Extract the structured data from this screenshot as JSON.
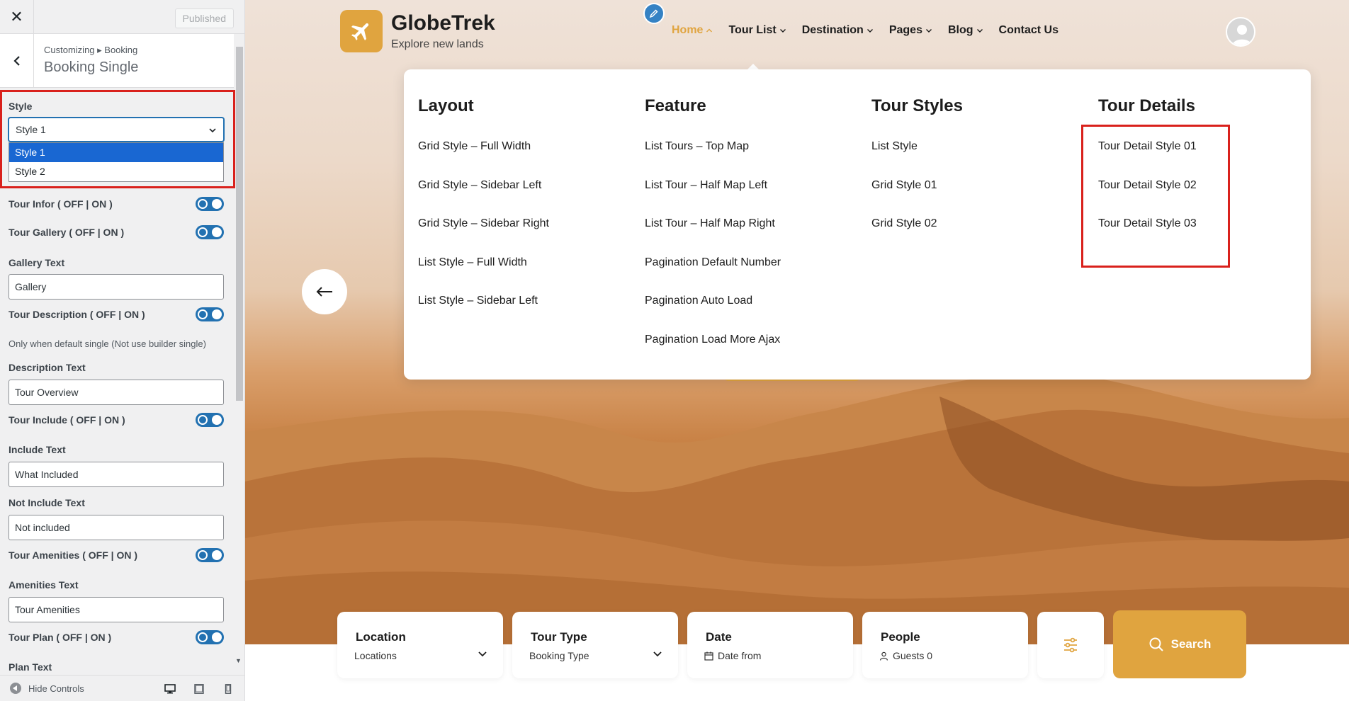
{
  "customizer": {
    "close_icon": "close-icon",
    "published_label": "Published",
    "breadcrumb": "Customizing ▸ Booking",
    "section_title": "Booking Single",
    "style_label": "Style",
    "style_value": "Style 1",
    "style_options": [
      "Style 1",
      "Style 2"
    ],
    "tour_infor_label": "Tour Infor ( OFF | ON )",
    "tour_gallery_label": "Tour Gallery ( OFF | ON )",
    "gallery_text_label": "Gallery Text",
    "gallery_text_value": "Gallery",
    "tour_description_label": "Tour Description ( OFF | ON )",
    "description_note": "Only when default single (Not use builder single)",
    "description_text_label": "Description Text",
    "description_text_value": "Tour Overview",
    "tour_include_label": "Tour Include ( OFF | ON )",
    "include_text_label": "Include Text",
    "include_text_value": "What Included",
    "not_include_text_label": "Not Include Text",
    "not_include_text_value": "Not included",
    "tour_amenities_label": "Tour Amenities ( OFF | ON )",
    "amenities_text_label": "Amenities Text",
    "amenities_text_value": "Tour Amenities",
    "tour_plan_label": "Tour Plan ( OFF | ON )",
    "plan_text_label": "Plan Text",
    "hide_controls_label": "Hide Controls",
    "accent_color": "#2271b1",
    "highlight_color": "#d9211c"
  },
  "site": {
    "logo_name": "GlobeTrek",
    "logo_tagline": "Explore new lands",
    "brand_color": "#e0a43f",
    "nav": [
      "Home",
      "Tour List",
      "Destination",
      "Pages",
      "Blog",
      "Contact Us"
    ],
    "mega_menu": {
      "columns": [
        {
          "title": "Layout",
          "items": [
            "Grid Style – Full Width",
            "Grid Style – Sidebar Left",
            "Grid Style – Sidebar Right",
            "List Style – Full Width",
            "List Style – Sidebar Left"
          ]
        },
        {
          "title": "Feature",
          "items": [
            "List Tours – Top Map",
            "List Tour – Half Map Left",
            "List Tour – Half Map Right",
            "Pagination Default Number",
            "Pagination Auto Load",
            "Pagination Load More Ajax"
          ]
        },
        {
          "title": "Tour Styles",
          "items": [
            "List Style",
            "Grid Style 01",
            "Grid Style 02"
          ]
        },
        {
          "title": "Tour Details",
          "items": [
            "Tour Detail Style 01",
            "Tour Detail Style 02",
            "Tour Detail Style 03"
          ]
        }
      ]
    },
    "search": {
      "location_title": "Location",
      "location_value": "Locations",
      "tour_type_title": "Tour Type",
      "tour_type_value": "Booking Type",
      "date_title": "Date",
      "date_value": "Date from",
      "people_title": "People",
      "people_value": "Guests 0",
      "search_label": "Search"
    }
  }
}
